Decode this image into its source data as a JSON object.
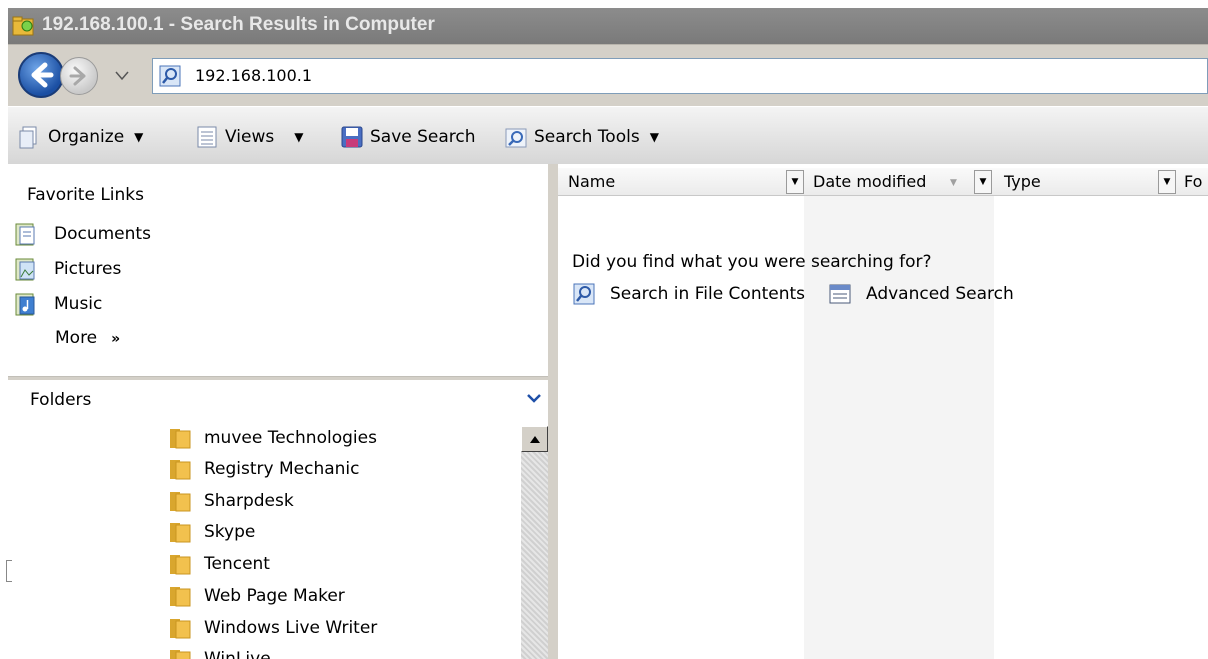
{
  "window": {
    "title": "192.168.100.1 - Search Results in Computer",
    "icon": "search-folder-icon"
  },
  "address_bar": {
    "back_icon": "back-arrow-icon",
    "forward_icon": "forward-arrow-icon",
    "history_icon": "chevron-down-icon",
    "address_icon": "search-icon",
    "value": "192.168.100.1"
  },
  "toolbar": {
    "organize": "Organize",
    "views": "Views",
    "save_search": "Save Search",
    "search_tools": "Search Tools"
  },
  "navigation": {
    "favorites_title": "Favorite Links",
    "favorites": [
      {
        "label": "Documents",
        "icon": "documents-icon"
      },
      {
        "label": "Pictures",
        "icon": "pictures-icon"
      },
      {
        "label": "Music",
        "icon": "music-icon"
      }
    ],
    "more": "More",
    "folders_title": "Folders",
    "folders": [
      "muvee Technologies",
      "Registry Mechanic",
      "Sharpdesk",
      "Skype",
      "Tencent",
      "Web Page Maker",
      "Windows Live Writer",
      "WinLive"
    ]
  },
  "content": {
    "columns": [
      "Name",
      "Date modified",
      "Type",
      "Fo"
    ],
    "prompt": "Did you find what you were searching for?",
    "suggestions": [
      {
        "label": "Search in File Contents",
        "icon": "search-icon"
      },
      {
        "label": "Advanced Search",
        "icon": "advanced-search-icon"
      }
    ]
  },
  "colors": {
    "titlebar": "#7a7a7a",
    "toolbar": "#e4e4e4",
    "chrome": "#d4d0c8",
    "folder": "#f2c14e"
  }
}
